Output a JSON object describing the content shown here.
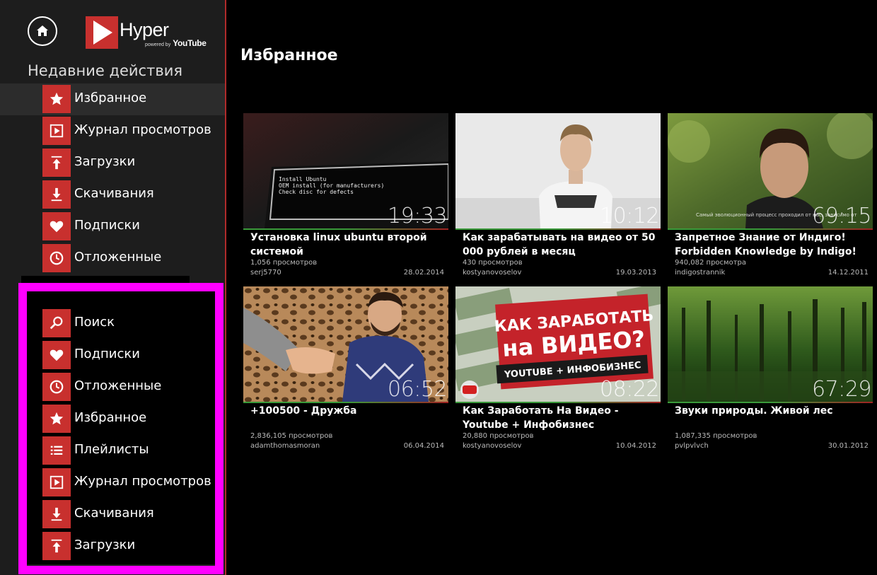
{
  "brand": {
    "name": "Hyper",
    "powered_by": "powered by",
    "partner": "YouTube",
    "accent": "#c8302e"
  },
  "sidebar": {
    "section_title": "Недавние действия",
    "recent_items": [
      {
        "label": "Избранное",
        "icon": "star-icon",
        "active": true
      },
      {
        "label": "Журнал просмотров",
        "icon": "play-history-icon"
      },
      {
        "label": "Загрузки",
        "icon": "upload-icon"
      },
      {
        "label": "Скачивания",
        "icon": "download-icon"
      },
      {
        "label": "Подписки",
        "icon": "heart-icon"
      },
      {
        "label": "Отложенные",
        "icon": "clock-icon"
      }
    ],
    "menu_items": [
      {
        "label": "Поиск",
        "icon": "search-icon"
      },
      {
        "label": "Подписки",
        "icon": "heart-icon"
      },
      {
        "label": "Отложенные",
        "icon": "clock-icon"
      },
      {
        "label": "Избранное",
        "icon": "star-icon"
      },
      {
        "label": "Плейлисты",
        "icon": "list-icon"
      },
      {
        "label": "Журнал просмотров",
        "icon": "play-history-icon"
      },
      {
        "label": "Скачивания",
        "icon": "download-icon"
      },
      {
        "label": "Загрузки",
        "icon": "upload-icon"
      }
    ],
    "highlight_color": "#ff00ff"
  },
  "main": {
    "title": "Избранное",
    "videos": [
      {
        "title": "Установка linux ubuntu второй системой",
        "views": "1,056 просмотров",
        "author": "serj5770",
        "date": "28.02.2014",
        "duration": "19:33",
        "thumb_lines": [
          "Install Ubuntu",
          "OEM install (for manufacturers)",
          "Check disc for defects"
        ]
      },
      {
        "title": "Как зарабатывать на видео от 50 000 рублей в месяц",
        "views": "430 просмотров",
        "author": "kostyanovoselov",
        "date": "19.03.2013",
        "duration": "10:12"
      },
      {
        "title": "Запретное Знание от Индиго! Forbidden Knowledge by Indigo!",
        "views": "940,082 просмотра",
        "author": "indigostrannik",
        "date": "14.12.2011",
        "duration": "69:15",
        "thumb_caption": "Самый эволюционный процесс проходил от нас, зависимо от"
      },
      {
        "title": "+100500 - Дружба",
        "views": "2,836,105 просмотров",
        "author": "adamthomasmoran",
        "date": "06.04.2014",
        "duration": "06:52"
      },
      {
        "title": "Как Заработать На Видео - Youtube + Инфобизнес",
        "views": "20,880 просмотров",
        "author": "kostyanovoselov",
        "date": "10.04.2012",
        "duration": "08:22",
        "thumb_lines": [
          "КАК ЗАРАБОТАТЬ",
          "на ВИДЕО?",
          "YOUTUBE + ИНФОБИЗНЕС"
        ]
      },
      {
        "title": "Звуки природы. Живой лес",
        "views": "1,087,335 просмотров",
        "author": "pvlpvlvch",
        "date": "30.01.2012",
        "duration": "67:29"
      }
    ]
  }
}
